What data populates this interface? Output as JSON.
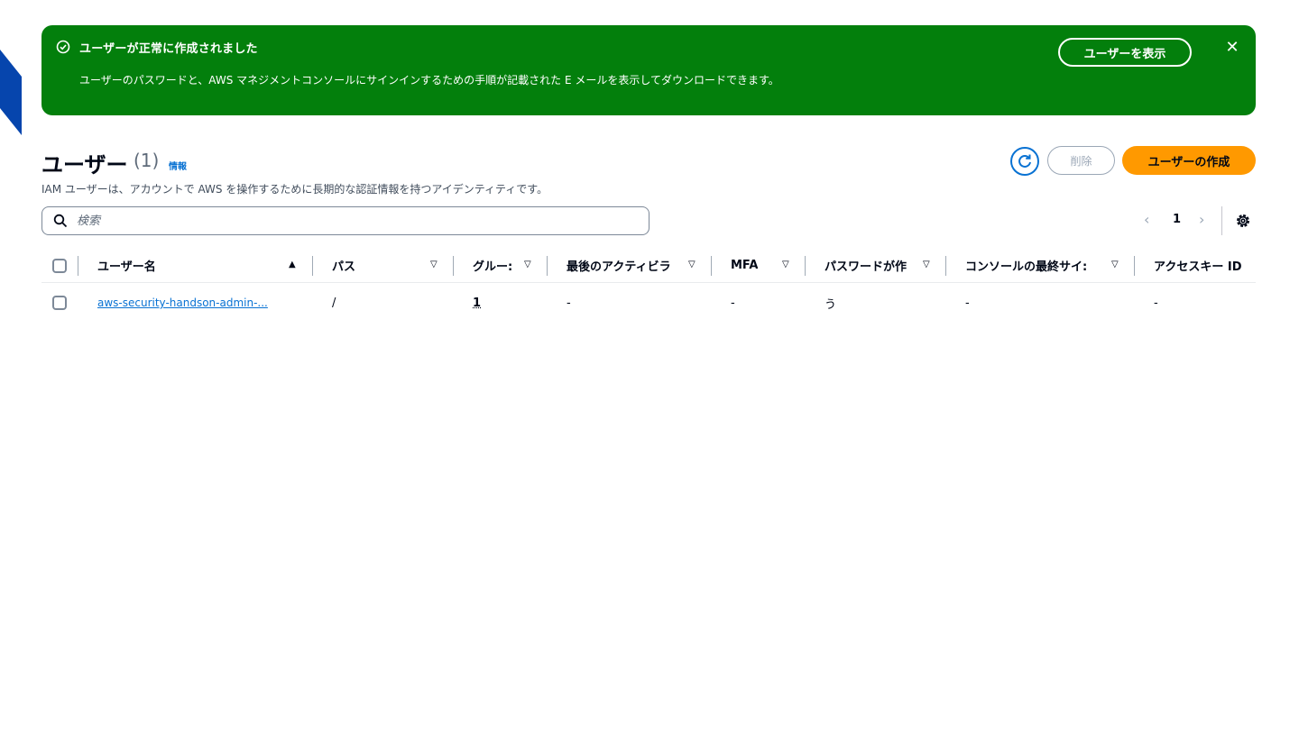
{
  "flash": {
    "title": "ユーザーが正常に作成されました",
    "description": "ユーザーのパスワードと、AWS マネジメントコンソールにサインインするための手順が記載された E メールを表示してダウンロードできます。",
    "view_button": "ユーザーを表示",
    "close": "✕",
    "color": "#037f0c"
  },
  "header": {
    "title": "ユーザー",
    "count": "(1)",
    "info": "情報",
    "description": "IAM ユーザーは、アカウントで AWS を操作するために長期的な認証情報を持つアイデンティティです。",
    "delete_button": "削除",
    "create_button": "ユーザーの作成"
  },
  "search": {
    "placeholder": "検索"
  },
  "pagination": {
    "prev": "‹",
    "page": "1",
    "next": "›"
  },
  "table": {
    "columns": [
      {
        "label": "ユーザー名",
        "sort": "▲"
      },
      {
        "label": "パス",
        "sort": "▽"
      },
      {
        "label": "グルー:",
        "sort": "▽"
      },
      {
        "label": "最後のアクティビラ",
        "sort": "▽"
      },
      {
        "label": "MFA",
        "sort": "▽"
      },
      {
        "label": "パスワードが作",
        "sort": "▽"
      },
      {
        "label": "コンソールの最終サイ:",
        "sort": "▽"
      },
      {
        "label": "アクセスキー ID",
        "sort": ""
      }
    ],
    "rows": [
      {
        "user_name": "aws-security-handson-admin-...",
        "path": "/",
        "groups": "1",
        "last_activity": "-",
        "mfa": "-",
        "password_age": "う",
        "console_last_signin": "-",
        "access_key_id": "-"
      }
    ]
  },
  "colors": {
    "accent": "#0972d3",
    "primary_button": "#ff9900",
    "success": "#037f0c"
  }
}
